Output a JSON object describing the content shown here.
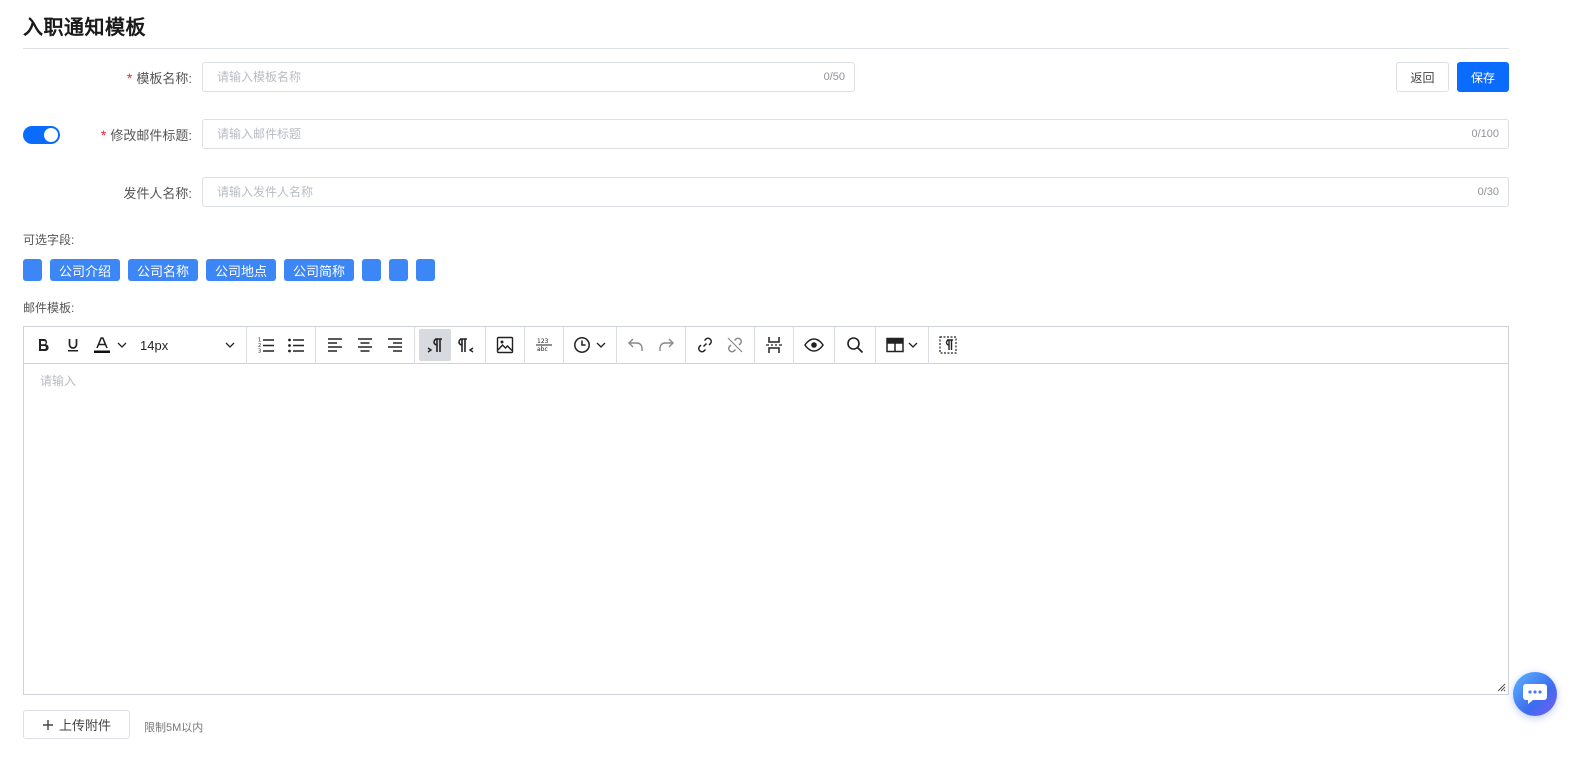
{
  "page": {
    "title": "入职通知模板"
  },
  "form": {
    "template_name": {
      "label": "模板名称:",
      "required": true,
      "placeholder": "请输入模板名称",
      "value": "",
      "counter": "0/50"
    },
    "email_subject": {
      "label": "修改邮件标题:",
      "required": true,
      "placeholder": "请输入邮件标题",
      "value": "",
      "counter": "0/100",
      "toggle_on": true
    },
    "sender_name": {
      "label": "发件人名称:",
      "required": false,
      "placeholder": "请输入发件人名称",
      "value": "",
      "counter": "0/30"
    }
  },
  "actions": {
    "back_label": "返回",
    "save_label": "保存"
  },
  "optional_fields": {
    "label": "可选字段:",
    "tags": [
      "",
      "公司介绍",
      "公司名称",
      "公司地点",
      "公司简称",
      "",
      "",
      ""
    ]
  },
  "email_template": {
    "label": "邮件模板:",
    "font_size": "14px",
    "placeholder": "请输入",
    "toolbar_icons": [
      "bold-icon",
      "underline-icon",
      "font-color-icon",
      "ordered-list-icon",
      "bullet-list-icon",
      "align-left-icon",
      "align-center-icon",
      "align-right-icon",
      "ltr-icon",
      "rtl-icon",
      "image-icon",
      "word-count-icon",
      "datetime-icon",
      "undo-icon",
      "redo-icon",
      "link-icon",
      "unlink-icon",
      "page-break-icon",
      "preview-icon",
      "search-icon",
      "table-icon",
      "show-blocks-icon"
    ]
  },
  "upload": {
    "button_label": "上传附件",
    "hint": "限制5M以内"
  },
  "colors": {
    "primary": "#0a6cff",
    "tag": "#3d86f5",
    "required": "#f5222d"
  }
}
